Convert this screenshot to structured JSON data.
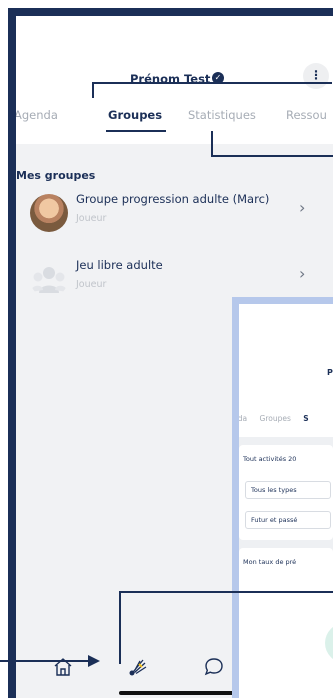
{
  "header": {
    "profile_name": "Prénom Test",
    "more_label": "⋮"
  },
  "tabs": [
    {
      "label": "Agenda",
      "active": false
    },
    {
      "label": "Groupes",
      "active": true
    },
    {
      "label": "Statistiques",
      "active": false
    },
    {
      "label": "Ressou",
      "active": false
    }
  ],
  "groups": {
    "section_title": "Mes groupes",
    "items": [
      {
        "name": "Groupe progression adulte (Marc)",
        "role": "Joueur"
      },
      {
        "name": "Jeu libre adulte",
        "role": "Joueur"
      }
    ]
  },
  "overlay": {
    "profile_initial": "P",
    "tabs": [
      "nda",
      "Groupes",
      "S"
    ],
    "activities_label": "Tout activités 20",
    "type_select": "Tous les types",
    "time_select": "Futur et passé",
    "rate_label": "Mon taux de pré"
  },
  "bottom_nav": {
    "items": [
      {
        "icon": "home-icon"
      },
      {
        "icon": "shuttlecock-icon"
      },
      {
        "icon": "chat-bubble-icon"
      }
    ]
  },
  "colors": {
    "primary": "#1b2f57",
    "inactive": "#a6acb5",
    "background": "#f1f2f4",
    "overlay_border": "#b6c8eb",
    "accent_green": "#dbf1ea"
  }
}
